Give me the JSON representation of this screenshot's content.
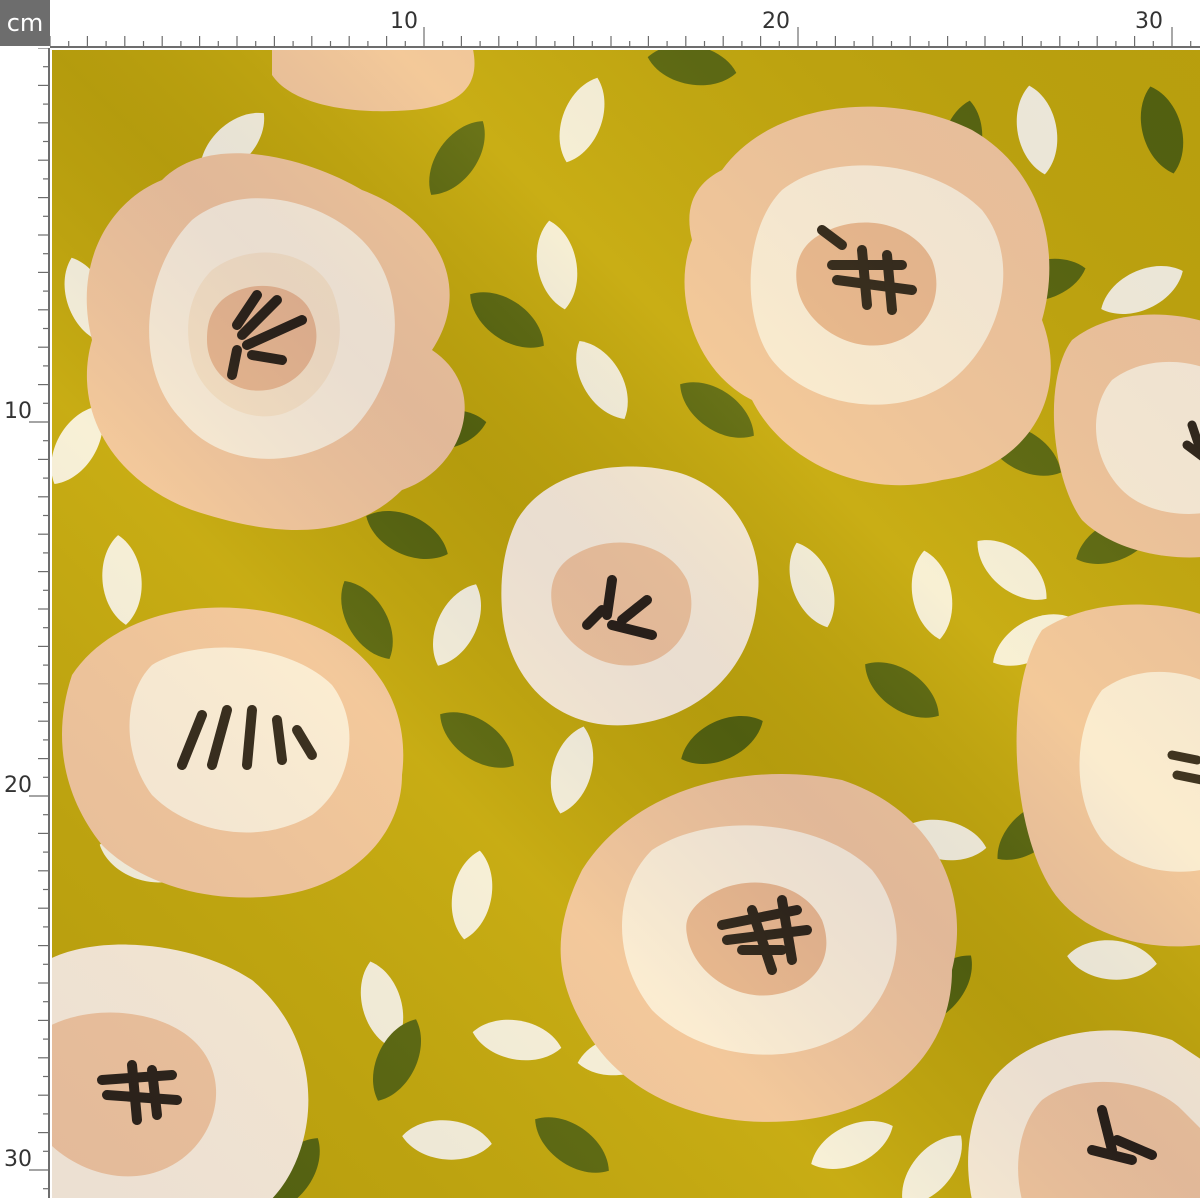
{
  "ruler": {
    "unit_label": "cm",
    "top_labels": [
      "10",
      "20",
      "30"
    ],
    "left_labels": [
      "10",
      "20",
      "30"
    ]
  },
  "colors": {
    "background": "#c2a70e",
    "petal_outer": "#f2c6a4",
    "petal_inner": "#f8e3cc",
    "petal_cream": "#fbeee0",
    "center_blush": "#eab896",
    "stamen": "#2a211c",
    "leaf_green": "#556411",
    "leaf_white": "#f7f2e6",
    "ruler_gray": "#6d6d6d"
  },
  "fabric": {
    "motif": "floral",
    "icons": [
      "flower-icon",
      "leaf-icon"
    ]
  }
}
